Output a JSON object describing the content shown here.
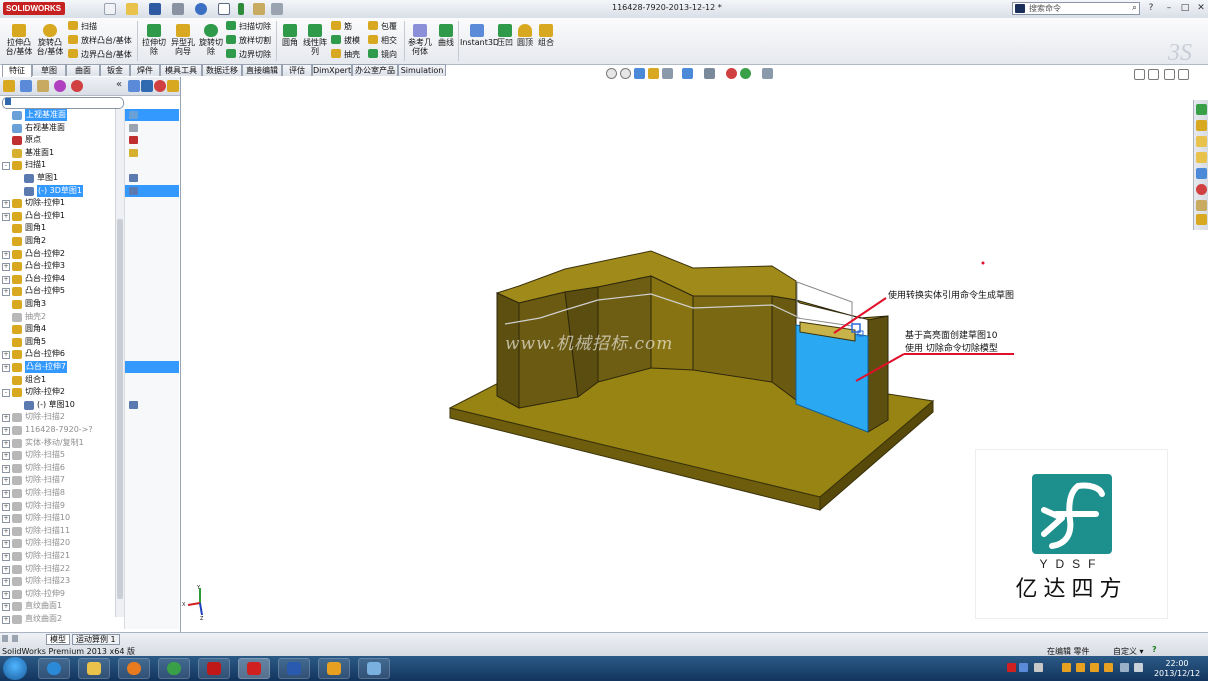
{
  "app": {
    "logo_text": "SOLIDWORKS",
    "document_title": "116428-7920-2013-12-12 *",
    "search_placeholder": "搜索命令",
    "search_go": "⌕",
    "win_help": "?",
    "win_min": "–",
    "win_max": "□",
    "win_close": "✕"
  },
  "command_manager": {
    "extrude_boss": "拉伸凸\n台/基体",
    "revolve_boss": "旋转凸\n台/基体",
    "sweep": "扫描",
    "loft_boss": "放样凸台/基体",
    "boundary_boss": "边界凸台/基体",
    "extrude_cut": "拉伸切\n除",
    "hole_wizard": "异型孔\n向导",
    "revolve_cut": "旋转切\n除",
    "swept_cut": "扫描切除",
    "lofted_cut": "放样切割",
    "boundary_cut": "边界切除",
    "fillet": "圆角",
    "linear_pattern": "线性阵\n列",
    "rib": "筋",
    "draft": "拔模",
    "shell": "抽壳",
    "wrap": "包覆",
    "intersect": "相交",
    "mirror": "镜向",
    "ref_geometry": "参考几\n何体",
    "curves": "曲线",
    "instant3d": "Instant3D",
    "indent": "压凹",
    "dome": "圆顶",
    "combine": "组合"
  },
  "tabs": [
    "特征",
    "草图",
    "曲面",
    "钣金",
    "焊件",
    "模具工具",
    "数据迁移",
    "直接编辑",
    "评估",
    "DimXpert",
    "办公室产品",
    "Simulation"
  ],
  "tree": [
    {
      "label": "上视基准面",
      "exp": "",
      "indent": 0,
      "state": "sel",
      "color": "#6aa0d8"
    },
    {
      "label": "右视基准面",
      "exp": "",
      "indent": 0,
      "state": "",
      "color": "#6aa0d8"
    },
    {
      "label": "原点",
      "exp": "",
      "indent": 0,
      "state": "",
      "color": "#c03030"
    },
    {
      "label": "基准面1",
      "exp": "",
      "indent": 0,
      "state": "",
      "color": "#d8b030"
    },
    {
      "label": "扫描1",
      "exp": "-",
      "indent": 0,
      "state": "",
      "color": "#d8a820"
    },
    {
      "label": "草图1",
      "exp": "",
      "indent": 1,
      "state": "",
      "color": "#5a7ab0"
    },
    {
      "label": "(-) 3D草图1",
      "exp": "",
      "indent": 1,
      "state": "sel",
      "color": "#5a7ab0"
    },
    {
      "label": "切除-拉伸1",
      "exp": "+",
      "indent": 0,
      "state": "",
      "color": "#d8a820"
    },
    {
      "label": "凸台-拉伸1",
      "exp": "+",
      "indent": 0,
      "state": "",
      "color": "#d8a820"
    },
    {
      "label": "圆角1",
      "exp": "",
      "indent": 0,
      "state": "",
      "color": "#d8a820"
    },
    {
      "label": "圆角2",
      "exp": "",
      "indent": 0,
      "state": "",
      "color": "#d8a820"
    },
    {
      "label": "凸台-拉伸2",
      "exp": "+",
      "indent": 0,
      "state": "",
      "color": "#d8a820"
    },
    {
      "label": "凸台-拉伸3",
      "exp": "+",
      "indent": 0,
      "state": "",
      "color": "#d8a820"
    },
    {
      "label": "凸台-拉伸4",
      "exp": "+",
      "indent": 0,
      "state": "",
      "color": "#d8a820"
    },
    {
      "label": "凸台-拉伸5",
      "exp": "+",
      "indent": 0,
      "state": "",
      "color": "#d8a820"
    },
    {
      "label": "圆角3",
      "exp": "",
      "indent": 0,
      "state": "",
      "color": "#d8a820"
    },
    {
      "label": "抽壳2",
      "exp": "",
      "indent": 0,
      "state": "gray",
      "color": "#b8b8b8"
    },
    {
      "label": "圆角4",
      "exp": "",
      "indent": 0,
      "state": "",
      "color": "#d8a820"
    },
    {
      "label": "圆角5",
      "exp": "",
      "indent": 0,
      "state": "",
      "color": "#d8a820"
    },
    {
      "label": "凸台-拉伸6",
      "exp": "+",
      "indent": 0,
      "state": "",
      "color": "#d8a820"
    },
    {
      "label": "凸台-拉伸7",
      "exp": "+",
      "indent": 0,
      "state": "sel",
      "color": "#d8a820"
    },
    {
      "label": "组合1",
      "exp": "",
      "indent": 0,
      "state": "",
      "color": "#d8a820"
    },
    {
      "label": "切除-拉伸2",
      "exp": "-",
      "indent": 0,
      "state": "",
      "color": "#d8a820"
    },
    {
      "label": "(-) 草图10",
      "exp": "",
      "indent": 1,
      "state": "",
      "color": "#5a7ab0"
    },
    {
      "label": "切除-扫描2",
      "exp": "+",
      "indent": 0,
      "state": "gray",
      "color": "#b8b8b8"
    },
    {
      "label": "116428-7920->?",
      "exp": "+",
      "indent": 0,
      "state": "gray",
      "color": "#b8b8b8"
    },
    {
      "label": "实体-移动/复制1",
      "exp": "+",
      "indent": 0,
      "state": "gray",
      "color": "#b8b8b8"
    },
    {
      "label": "切除-扫描5",
      "exp": "+",
      "indent": 0,
      "state": "gray",
      "color": "#b8b8b8"
    },
    {
      "label": "切除-扫描6",
      "exp": "+",
      "indent": 0,
      "state": "gray",
      "color": "#b8b8b8"
    },
    {
      "label": "切除-扫描7",
      "exp": "+",
      "indent": 0,
      "state": "gray",
      "color": "#b8b8b8"
    },
    {
      "label": "切除-扫描8",
      "exp": "+",
      "indent": 0,
      "state": "gray",
      "color": "#b8b8b8"
    },
    {
      "label": "切除-扫描9",
      "exp": "+",
      "indent": 0,
      "state": "gray",
      "color": "#b8b8b8"
    },
    {
      "label": "切除-扫描10",
      "exp": "+",
      "indent": 0,
      "state": "gray",
      "color": "#b8b8b8"
    },
    {
      "label": "切除-扫描11",
      "exp": "+",
      "indent": 0,
      "state": "gray",
      "color": "#b8b8b8"
    },
    {
      "label": "切除-扫描20",
      "exp": "+",
      "indent": 0,
      "state": "gray",
      "color": "#b8b8b8"
    },
    {
      "label": "切除-扫描21",
      "exp": "+",
      "indent": 0,
      "state": "gray",
      "color": "#b8b8b8"
    },
    {
      "label": "切除-扫描22",
      "exp": "+",
      "indent": 0,
      "state": "gray",
      "color": "#b8b8b8"
    },
    {
      "label": "切除-扫描23",
      "exp": "+",
      "indent": 0,
      "state": "gray",
      "color": "#b8b8b8"
    },
    {
      "label": "切除-拉伸9",
      "exp": "+",
      "indent": 0,
      "state": "gray",
      "color": "#b8b8b8"
    },
    {
      "label": "直纹曲面1",
      "exp": "+",
      "indent": 0,
      "state": "gray",
      "color": "#b8b8b8"
    },
    {
      "label": "直纹曲面2",
      "exp": "+",
      "indent": 0,
      "state": "gray",
      "color": "#b8b8b8"
    }
  ],
  "bottom_tabs": [
    "模型",
    "运动算例 1"
  ],
  "annotations": {
    "convert_entities": "使用转换实体引用命令生成草图",
    "sketch10_line1": "基于高亮面创建草图10",
    "sketch10_line2": "使用  切除命令切除模型"
  },
  "watermark": "www.机械招标.com",
  "brand": {
    "letters": "YDSF",
    "chinese": "亿达四方"
  },
  "status": {
    "product": "SolidWorks Premium 2013 x64 版",
    "mode": "在编辑 零件",
    "custom": "自定义 ▾",
    "help": "?"
  },
  "clock": {
    "time": "22:00",
    "date": "2013/12/12"
  },
  "colors": {
    "model_top": "#8d7d0c",
    "model_side": "#6e5d12",
    "model_front": "#5c4f10",
    "highlight": "#2aa8f2",
    "selection": "#3399ff",
    "annotation_line": "#e0102a"
  }
}
